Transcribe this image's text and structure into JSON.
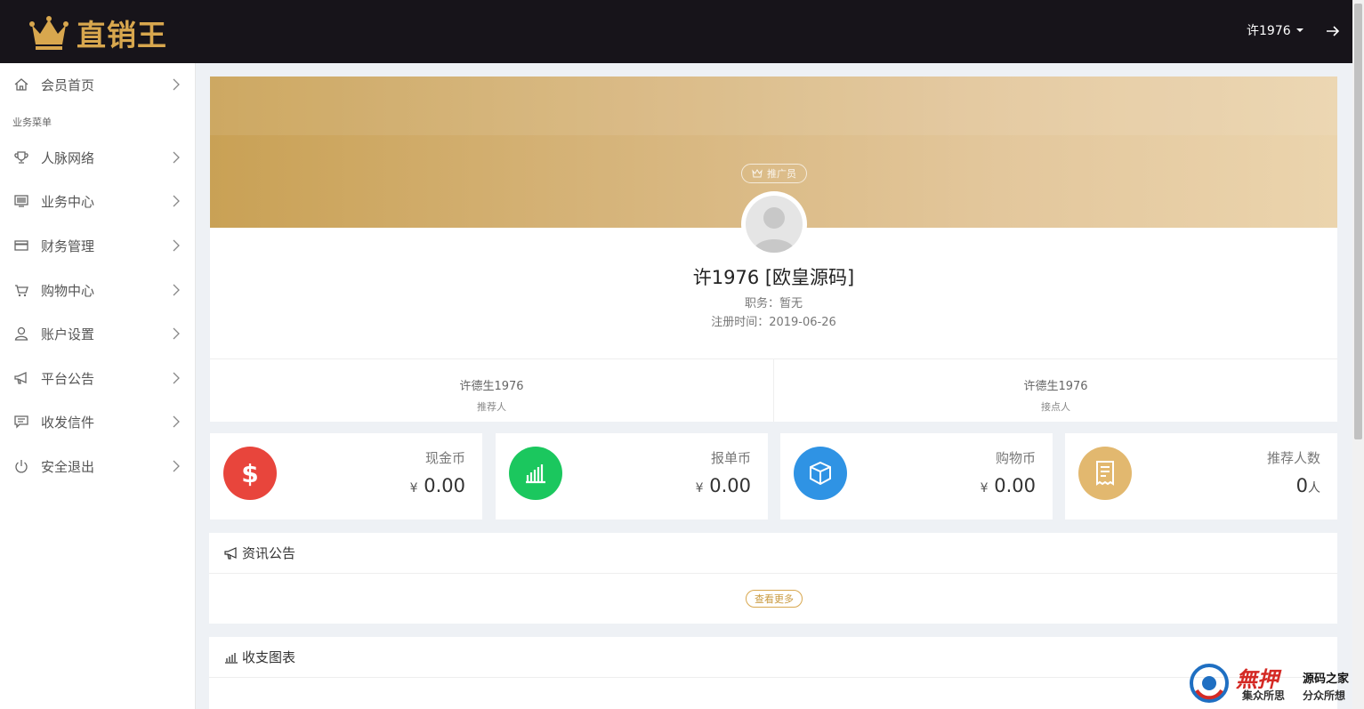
{
  "header": {
    "brand": "直销王",
    "username": "许1976"
  },
  "sidebar": {
    "home": "会员首页",
    "section_title": "业务菜单",
    "items": [
      {
        "label": "人脉网络",
        "icon": "trophy-icon"
      },
      {
        "label": "业务中心",
        "icon": "monitor-icon"
      },
      {
        "label": "财务管理",
        "icon": "card-icon"
      },
      {
        "label": "购物中心",
        "icon": "cart-icon"
      },
      {
        "label": "账户设置",
        "icon": "user-icon"
      },
      {
        "label": "平台公告",
        "icon": "megaphone-icon"
      },
      {
        "label": "收发信件",
        "icon": "message-icon"
      },
      {
        "label": "安全退出",
        "icon": "power-icon"
      }
    ]
  },
  "profile": {
    "badge": "推广员",
    "name": "许1976 [欧皇源码]",
    "position": "职务：暂无",
    "register_time": "注册时间：2019-06-26",
    "referrer_name": "许德生1976",
    "referrer_label": "推荐人",
    "contact_name": "许德生1976",
    "contact_label": "接点人"
  },
  "stats": [
    {
      "label": "现金币",
      "prefix": "¥",
      "value": "0.00",
      "color": "#e8453c",
      "icon": "dollar-icon"
    },
    {
      "label": "报单币",
      "prefix": "¥",
      "value": "0.00",
      "color": "#1bc75e",
      "icon": "bar-chart-icon"
    },
    {
      "label": "购物币",
      "prefix": "¥",
      "value": "0.00",
      "color": "#2f93e4",
      "icon": "box-icon"
    },
    {
      "label": "推荐人数",
      "prefix": "",
      "value": "0",
      "unit": "人",
      "color": "#e2b86f",
      "icon": "receipt-icon"
    }
  ],
  "news": {
    "title": "资讯公告",
    "more": "查看更多"
  },
  "chart_panel": {
    "title": "收支图表"
  },
  "watermark": {
    "big": "無押",
    "line1": "源码之家",
    "line2a": "集众所思",
    "line2b": "分众所想"
  },
  "colors": {
    "topbar": "#17141a",
    "accent_gold": "#d8a74e"
  }
}
